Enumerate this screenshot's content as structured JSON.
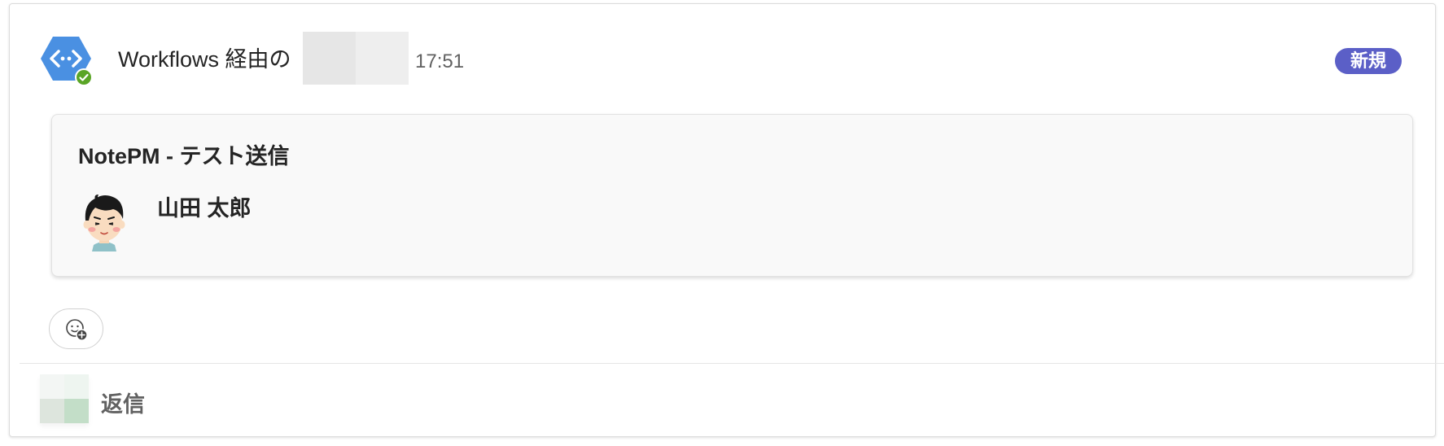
{
  "message": {
    "sender_prefix": "Workflows 経由の",
    "timestamp": "17:51",
    "badge": "新規"
  },
  "card": {
    "title": "NotePM - テスト送信",
    "user_name": "山田 太郎"
  },
  "actions": {
    "reaction_icon": "add-reaction-icon",
    "reply_label": "返信"
  },
  "colors": {
    "app_icon": "#4a90e2",
    "verified": "#5aa526",
    "badge": "#5b5fc7"
  }
}
